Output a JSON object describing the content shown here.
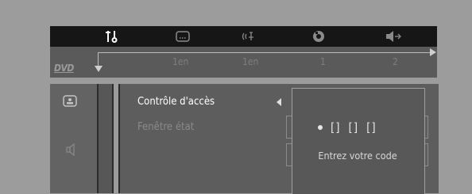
{
  "tabs": [
    {
      "icon": "settings-sliders-icon",
      "active": true
    },
    {
      "icon": "subtitle-icon",
      "value": "1en"
    },
    {
      "icon": "audio-language-icon",
      "value": "1en"
    },
    {
      "icon": "camera-angle-icon",
      "value": "1"
    },
    {
      "icon": "audio-output-icon",
      "value": "2"
    }
  ],
  "disc_logo": "DVD",
  "side_icons": [
    "picture-settings-icon",
    "speaker-icon"
  ],
  "menu": {
    "items": [
      "Contrôle d'accès",
      "Fenêtre état"
    ],
    "selected_index": 0
  },
  "popup": {
    "code_slots": [
      "[]",
      "[]",
      "[]"
    ],
    "prompt": "Entrez votre code"
  },
  "colors": {
    "background": "#9c9c9c",
    "tab_bar": "#161616",
    "panel": "#5d5d5d",
    "text_active": "#ffffff",
    "text_inactive": "#8a8a8a"
  }
}
